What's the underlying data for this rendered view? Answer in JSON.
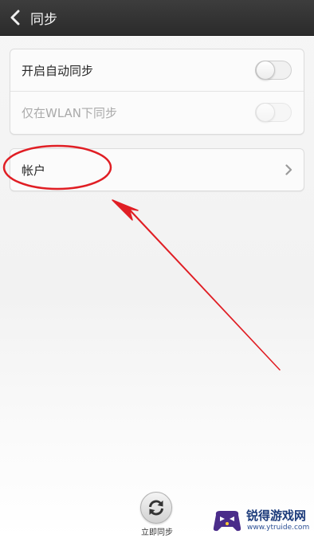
{
  "header": {
    "title": "同步"
  },
  "settings": {
    "auto_sync_label": "开启自动同步",
    "auto_sync_on": false,
    "wlan_only_label": "仅在WLAN下同步",
    "wlan_only_on": false,
    "wlan_only_enabled": false
  },
  "accounts": {
    "label": "帐户"
  },
  "footer": {
    "sync_now_label": "立即同步"
  },
  "watermark": {
    "title": "锐得游戏网",
    "url": "www.ytruide.com"
  },
  "colors": {
    "annotation": "#e01e24",
    "header": "#2f2f2f",
    "watermark_text": "#1b3a7a"
  }
}
